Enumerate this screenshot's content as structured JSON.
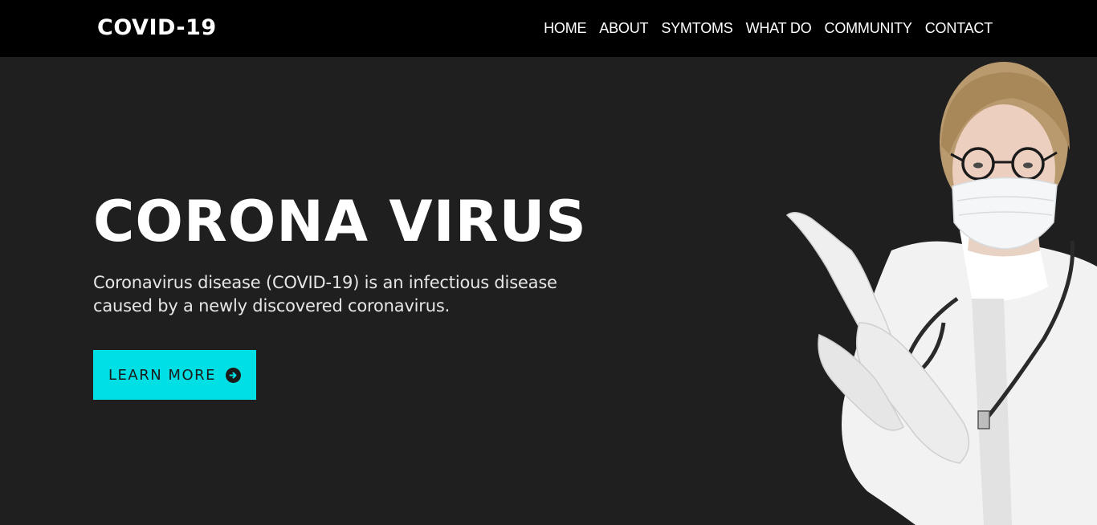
{
  "header": {
    "brand": "COVID-19",
    "nav": [
      "HOME",
      "ABOUT",
      "SYMTOMS",
      "WHAT DO",
      "COMMUNITY",
      "CONTACT"
    ]
  },
  "hero": {
    "title": "CORONA VIRUS",
    "description": "Coronavirus disease (COVID-19) is an infectious disease caused by a newly discovered coronavirus.",
    "cta_label": "LEARN MORE",
    "cta_icon": "arrow-circle-right-icon",
    "image": "doctor-with-mask-and-gloves"
  },
  "colors": {
    "background": "#201f1f",
    "navbar": "#000000",
    "accent": "#00e0e4",
    "text": "#ffffff"
  }
}
